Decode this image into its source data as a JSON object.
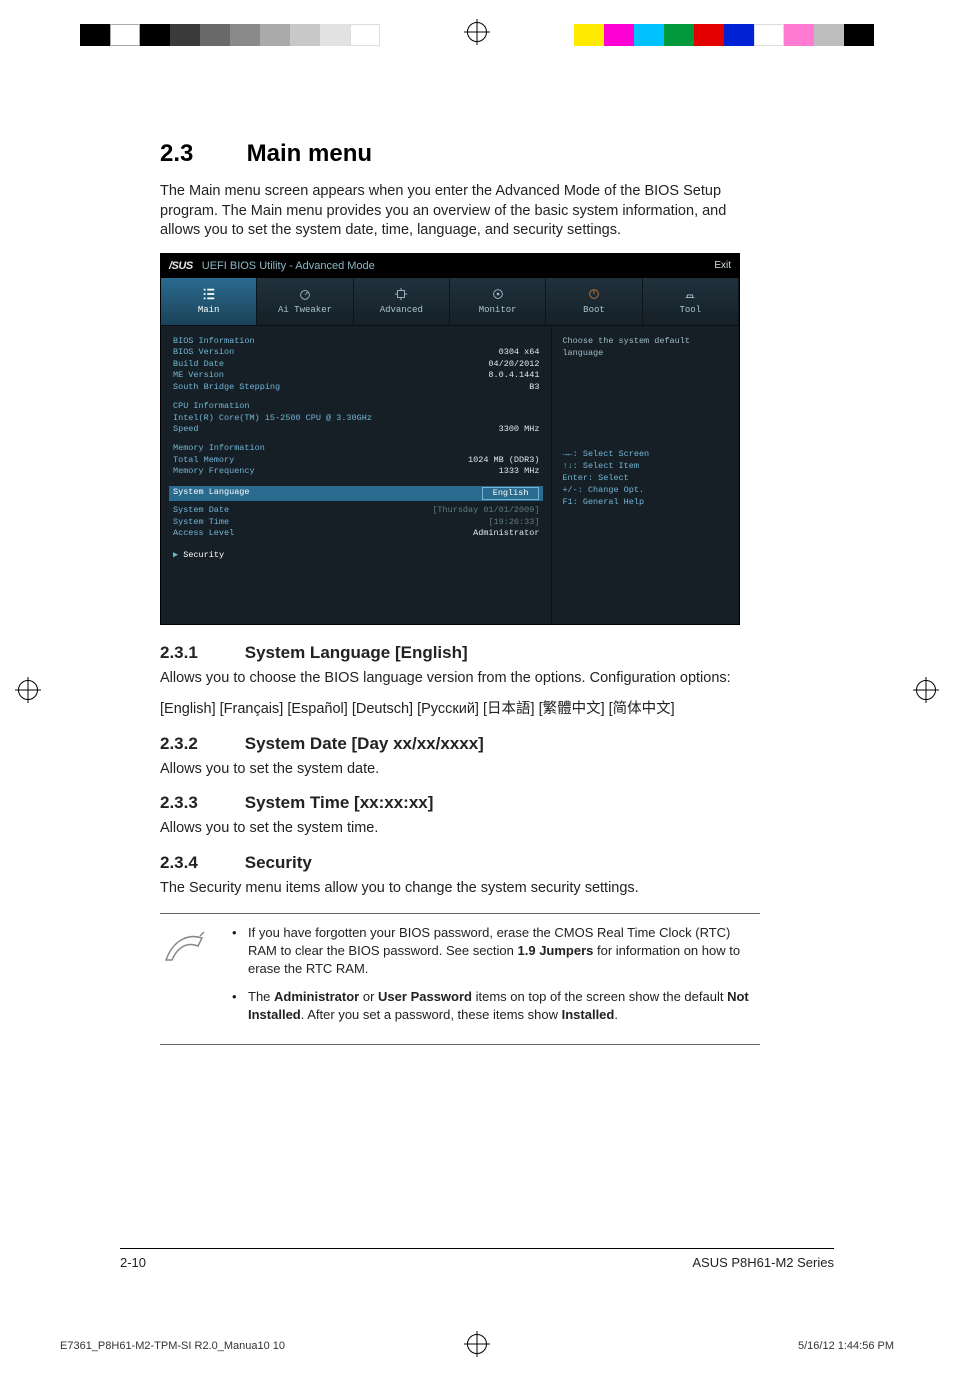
{
  "section": {
    "number": "2.3",
    "title": "Main menu"
  },
  "intro": "The Main menu screen appears when you enter the Advanced Mode of the BIOS Setup program. The Main menu provides you an overview of the basic system information, and allows you to set the system date, time, language, and security settings.",
  "bios": {
    "headerTitle": "UEFI BIOS Utility - Advanced Mode",
    "brand": "/SUS",
    "exit": "Exit",
    "tabs": [
      "Main",
      "Ai Tweaker",
      "Advanced",
      "Monitor",
      "Boot",
      "Tool"
    ],
    "info": {
      "heading1": "BIOS Information",
      "biosVersion": {
        "label": "BIOS Version",
        "value": "0304 x64"
      },
      "buildDate": {
        "label": "Build Date",
        "value": "04/20/2012"
      },
      "meVersion": {
        "label": "ME Version",
        "value": "8.0.4.1441"
      },
      "sbStep": {
        "label": "South Bridge Stepping",
        "value": "B3"
      },
      "heading2": "CPU Information",
      "cpuName": "Intel(R) Core(TM) i5-2500 CPU @ 3.30GHz",
      "speed": {
        "label": "Speed",
        "value": "3300 MHz"
      },
      "heading3": "Memory Information",
      "totalMem": {
        "label": "Total Memory",
        "value": "1024 MB (DDR3)"
      },
      "memFreq": {
        "label": "Memory Frequency",
        "value": "1333 MHz"
      },
      "langLabel": "System Language",
      "langValue": "English",
      "sysDate": {
        "label": "System Date",
        "value": "[Thursday 01/01/2009]"
      },
      "sysTime": {
        "label": "System Time",
        "value": "[19:26:33]"
      },
      "access": {
        "label": "Access Level",
        "value": "Administrator"
      },
      "security": "Security"
    },
    "helpText": "Choose the system default language",
    "keys": [
      "→←: Select Screen",
      "↑↓: Select Item",
      "Enter: Select",
      "+/-: Change Opt.",
      "F1: General Help"
    ]
  },
  "sub1": {
    "num": "2.3.1",
    "title": "System Language [English]",
    "p1": "Allows you to choose the BIOS language version from the options. Configuration options:",
    "p2": "[English] [Français] [Español] [Deutsch] [Русский] [日本語] [繁體中文] [简体中文]"
  },
  "sub2": {
    "num": "2.3.2",
    "title": "System Date [Day xx/xx/xxxx]",
    "p": "Allows you to set the system date."
  },
  "sub3": {
    "num": "2.3.3",
    "title": "System Time [xx:xx:xx]",
    "p": "Allows you to set the system time."
  },
  "sub4": {
    "num": "2.3.4",
    "title": "Security",
    "p": "The Security menu items allow you to change the system security settings."
  },
  "notes": {
    "a_pre": "If you have forgotten your BIOS password, erase the CMOS Real Time Clock (RTC) RAM to clear the BIOS password. See section ",
    "a_bold": "1.9 Jumpers",
    "a_post": " for information on how to erase the RTC RAM.",
    "b_pre": "The ",
    "b_b1": "Administrator",
    "b_mid1": " or ",
    "b_b2": "User Password",
    "b_mid2": " items on top of the screen show the default ",
    "b_b3": "Not Installed",
    "b_mid3": ". After you set a password, these items show ",
    "b_b4": "Installed",
    "b_post": "."
  },
  "footer": {
    "page": "2-10",
    "product": "ASUS P8H61-M2 Series"
  },
  "printFooter": {
    "file": "E7361_P8H61-M2-TPM-SI R2.0_Manua10   10",
    "stamp": "5/16/12   1:44:56 PM"
  }
}
